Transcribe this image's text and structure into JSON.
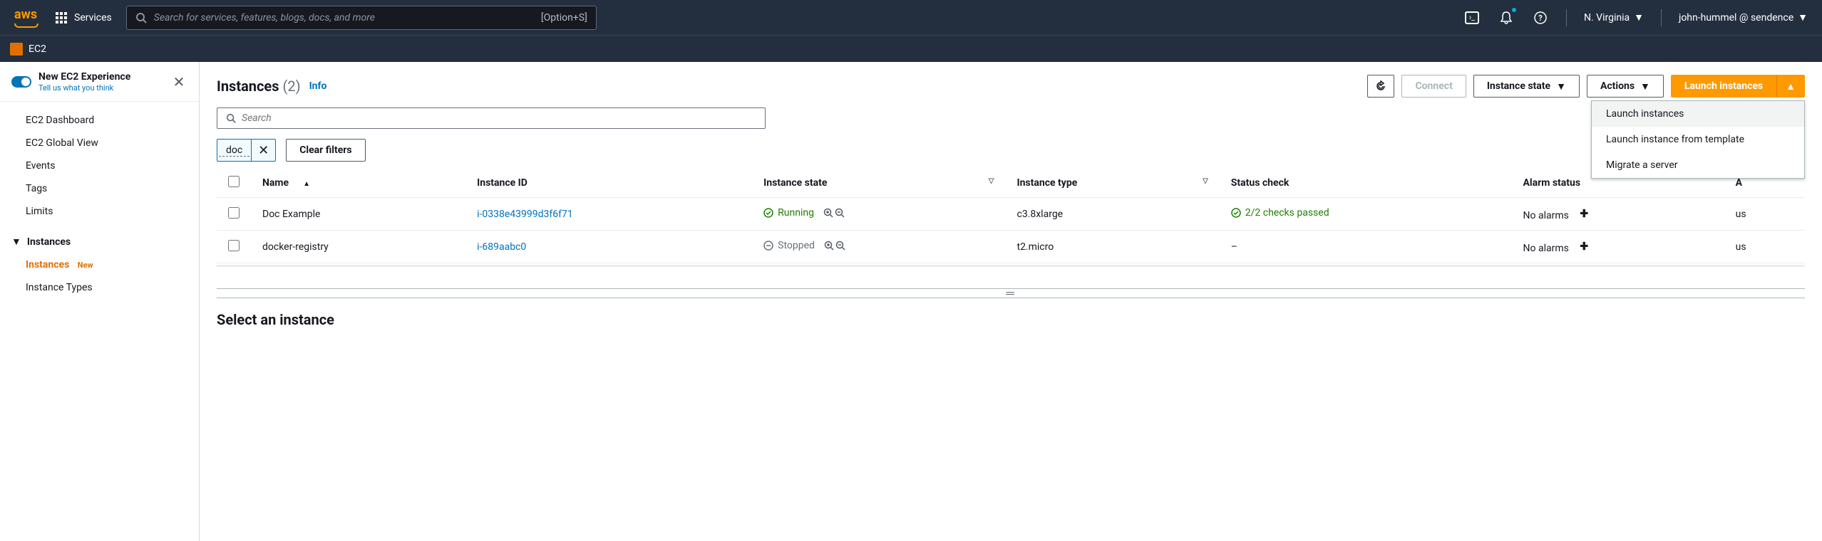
{
  "topnav": {
    "logo_text": "aws",
    "services_label": "Services",
    "search_placeholder": "Search for services, features, blogs, docs, and more",
    "search_hint": "[Option+S]",
    "region": "N. Virginia",
    "account": "john-hummel @ sendence"
  },
  "service_bar": {
    "name": "EC2"
  },
  "sidebar": {
    "new_experience_title": "New EC2 Experience",
    "new_experience_sub": "Tell us what you think",
    "top_items": [
      "EC2 Dashboard",
      "EC2 Global View",
      "Events",
      "Tags",
      "Limits"
    ],
    "group_instances": "Instances",
    "instances_items": [
      {
        "label": "Instances",
        "active": true,
        "new": true
      },
      {
        "label": "Instance Types",
        "active": false,
        "new": false
      }
    ]
  },
  "page": {
    "title_prefix": "Instances",
    "count_display": "(2)",
    "info_label": "Info",
    "search_placeholder": "Search",
    "filter_chip": "doc",
    "clear_filters": "Clear filters",
    "select_instance": "Select an instance"
  },
  "actions": {
    "connect": "Connect",
    "instance_state": "Instance state",
    "actions": "Actions",
    "launch": "Launch instances"
  },
  "dropdown": {
    "items": [
      "Launch instances",
      "Launch instance from template",
      "Migrate a server"
    ]
  },
  "table": {
    "headers": {
      "name": "Name",
      "instance_id": "Instance ID",
      "instance_state": "Instance state",
      "instance_type": "Instance type",
      "status_check": "Status check",
      "alarm_status": "Alarm status",
      "az": "A"
    },
    "rows": [
      {
        "name": "Doc Example",
        "instance_id": "i-0338e43999d3f6f71",
        "state": "Running",
        "state_kind": "running",
        "type": "c3.8xlarge",
        "status": "2/2 checks passed",
        "status_kind": "pass",
        "alarm": "No alarms",
        "az": "us"
      },
      {
        "name": "docker-registry",
        "instance_id": "i-689aabc0",
        "state": "Stopped",
        "state_kind": "stopped",
        "type": "t2.micro",
        "status": "–",
        "status_kind": "none",
        "alarm": "No alarms",
        "az": "us"
      }
    ]
  }
}
